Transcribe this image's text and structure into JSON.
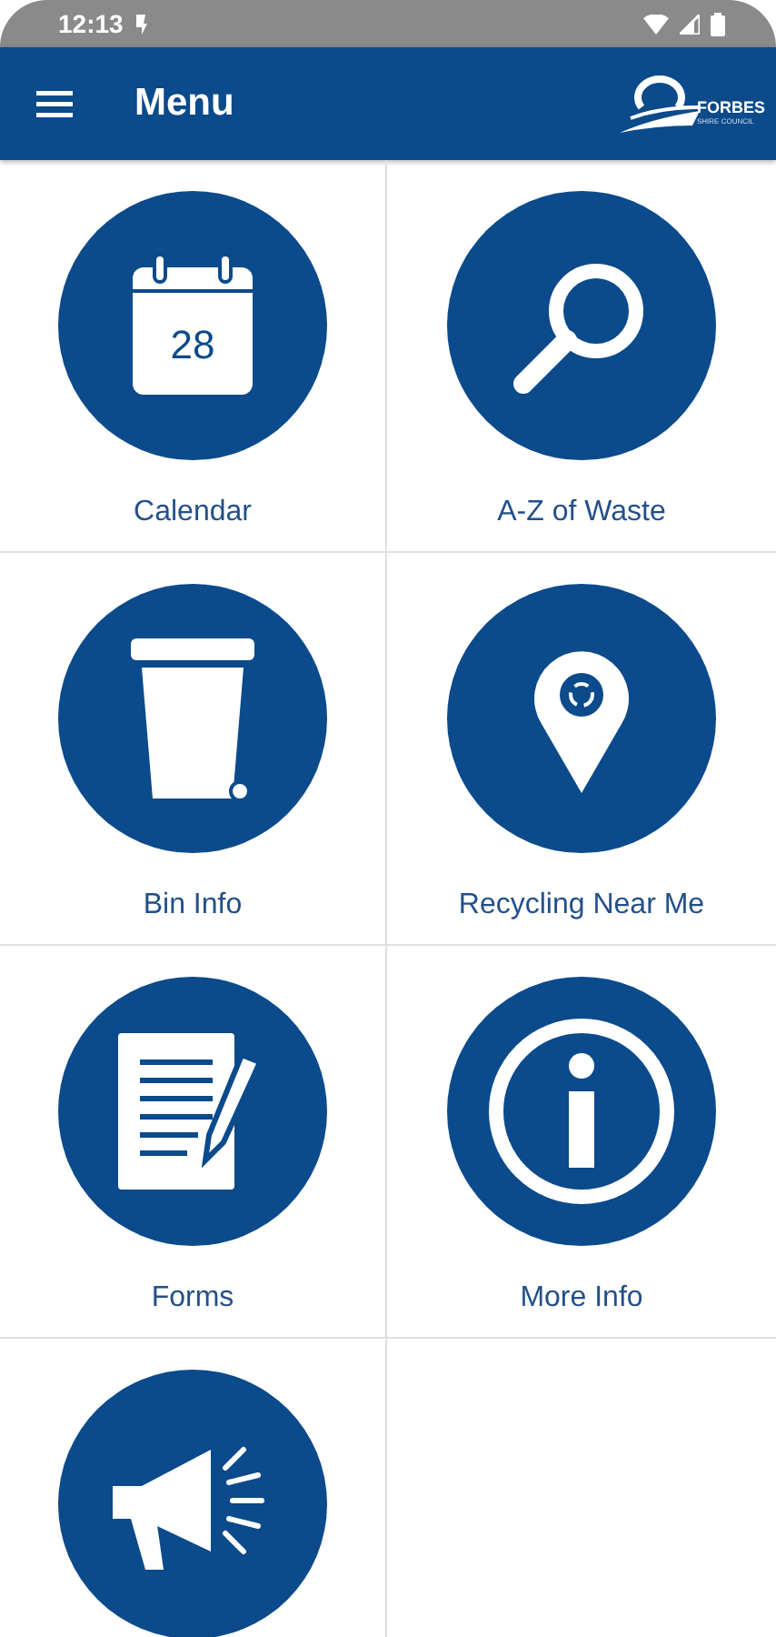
{
  "status_bar": {
    "time": "12:13"
  },
  "app_bar": {
    "title": "Menu",
    "logo": {
      "name": "FORBES",
      "subtitle": "SHIRE COUNCIL"
    }
  },
  "items": [
    {
      "kind": "calendar",
      "label": "Calendar",
      "day": "28"
    },
    {
      "kind": "search",
      "label": "A-Z of Waste"
    },
    {
      "kind": "bin",
      "label": "Bin Info"
    },
    {
      "kind": "pin",
      "label": "Recycling Near Me"
    },
    {
      "kind": "form",
      "label": "Forms"
    },
    {
      "kind": "info",
      "label": "More Info"
    },
    {
      "kind": "megaphone"
    }
  ]
}
